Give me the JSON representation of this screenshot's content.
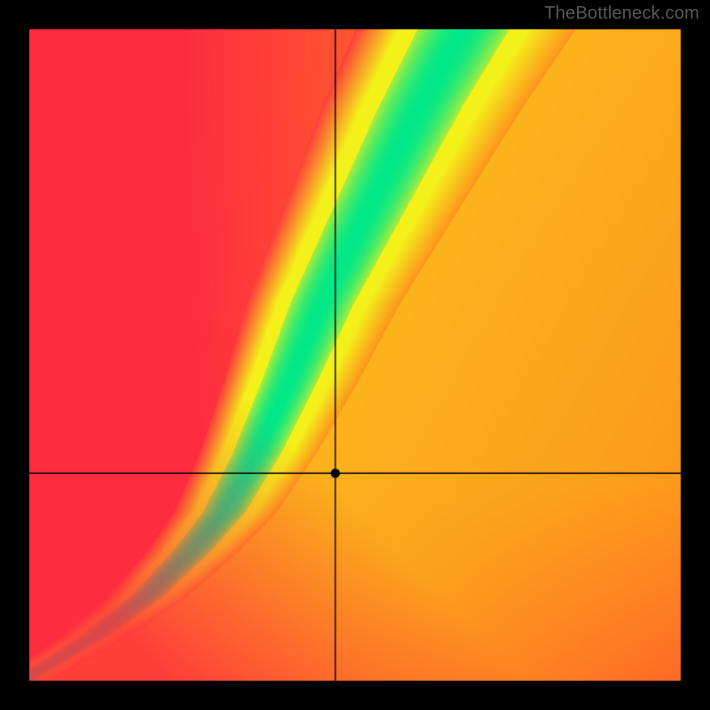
{
  "attribution": "TheBottleneck.com",
  "chart_data": {
    "type": "heatmap",
    "title": "",
    "xlabel": "",
    "ylabel": "",
    "xlim": [
      0,
      1
    ],
    "ylim": [
      0,
      1
    ],
    "crosshair": {
      "x": 0.47,
      "y": 0.32
    },
    "marker": {
      "x": 0.47,
      "y": 0.32
    },
    "optimal_ridge": {
      "description": "approximate locus of green (optimal) band; y as function of x in normalized [0,1] coords",
      "points": [
        {
          "x": 0.02,
          "y": 0.02
        },
        {
          "x": 0.1,
          "y": 0.07
        },
        {
          "x": 0.18,
          "y": 0.13
        },
        {
          "x": 0.25,
          "y": 0.2
        },
        {
          "x": 0.3,
          "y": 0.26
        },
        {
          "x": 0.35,
          "y": 0.35
        },
        {
          "x": 0.4,
          "y": 0.46
        },
        {
          "x": 0.45,
          "y": 0.58
        },
        {
          "x": 0.5,
          "y": 0.68
        },
        {
          "x": 0.55,
          "y": 0.78
        },
        {
          "x": 0.6,
          "y": 0.88
        },
        {
          "x": 0.65,
          "y": 0.97
        }
      ]
    },
    "ridge_half_width_x": 0.035,
    "colors": {
      "optimal": "#00E888",
      "near": "#F4F01A",
      "far_left_bottom": "#FF2B3F",
      "far_right_top": "#FF8A1C"
    },
    "outer_border_px": 30,
    "inner_border_px": 3
  }
}
